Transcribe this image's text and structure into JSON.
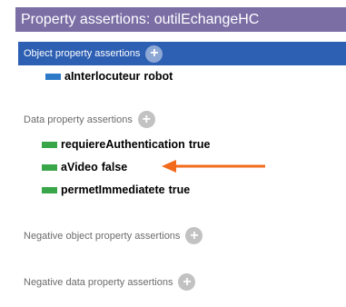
{
  "panel": {
    "title": "Property assertions: outilEchangeHC"
  },
  "sections": {
    "object": {
      "label": "Object property assertions"
    },
    "data": {
      "label": "Data property assertions"
    },
    "neg_object": {
      "label": "Negative object property assertions"
    },
    "neg_data": {
      "label": "Negative data property assertions"
    }
  },
  "object_assertions": [
    {
      "property": "aInterlocuteur",
      "value": "robot"
    }
  ],
  "data_assertions": [
    {
      "property": "requiereAuthentication",
      "value": "true"
    },
    {
      "property": "aVideo",
      "value": "false"
    },
    {
      "property": "permetImmediatete",
      "value": "true"
    }
  ],
  "icons": {
    "add": "add-circle-icon",
    "object_chip": "object-property-icon",
    "data_chip": "data-property-icon"
  },
  "colors": {
    "title_bar": "#7a6ea5",
    "selected_header": "#2d5fb3",
    "object_chip": "#2e79c7",
    "data_chip": "#3aa64a",
    "arrow": "#f26a1b"
  }
}
